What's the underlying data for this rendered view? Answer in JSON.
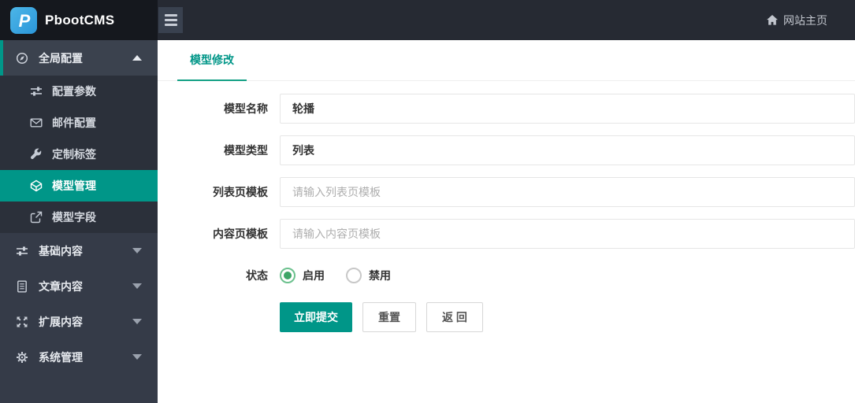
{
  "colors": {
    "accent": "#009688",
    "header_bg": "#262a33",
    "logo_bg": "#15181e",
    "sidebar_bg": "#353b48",
    "submenu_bg": "#2b303a",
    "radio_checked": "#3da567"
  },
  "header": {
    "brand": "PbootCMS",
    "logo_letter": "P",
    "menu_icon": "hamburger-icon",
    "home_icon": "home-icon",
    "home_label": "网站主页"
  },
  "sidebar": {
    "sections": [
      {
        "label": "全局配置",
        "icon": "compass-icon",
        "expanded": true
      },
      {
        "label": "基础内容",
        "icon": "sliders-icon",
        "expanded": false
      },
      {
        "label": "文章内容",
        "icon": "file-icon",
        "expanded": false
      },
      {
        "label": "扩展内容",
        "icon": "arrows-icon",
        "expanded": false
      },
      {
        "label": "系统管理",
        "icon": "gear-icon",
        "expanded": false
      }
    ],
    "submenu": [
      {
        "label": "配置参数",
        "icon": "sliders-icon",
        "active": false
      },
      {
        "label": "邮件配置",
        "icon": "envelope-icon",
        "active": false
      },
      {
        "label": "定制标签",
        "icon": "wrench-icon",
        "active": false
      },
      {
        "label": "模型管理",
        "icon": "cube-icon",
        "active": true
      },
      {
        "label": "模型字段",
        "icon": "external-link-icon",
        "active": false
      }
    ]
  },
  "main": {
    "tab": "模型修改",
    "form": {
      "rows": [
        {
          "label": "模型名称",
          "value": "轮播",
          "placeholder": ""
        },
        {
          "label": "模型类型",
          "value": "列表",
          "placeholder": ""
        },
        {
          "label": "列表页模板",
          "value": "",
          "placeholder": "请输入列表页模板"
        },
        {
          "label": "内容页模板",
          "value": "",
          "placeholder": "请输入内容页模板"
        }
      ],
      "status_label": "状态",
      "radios": [
        {
          "label": "启用",
          "checked": true
        },
        {
          "label": "禁用",
          "checked": false
        }
      ],
      "buttons": {
        "submit": "立即提交",
        "reset": "重置",
        "back": "返 回"
      }
    }
  }
}
